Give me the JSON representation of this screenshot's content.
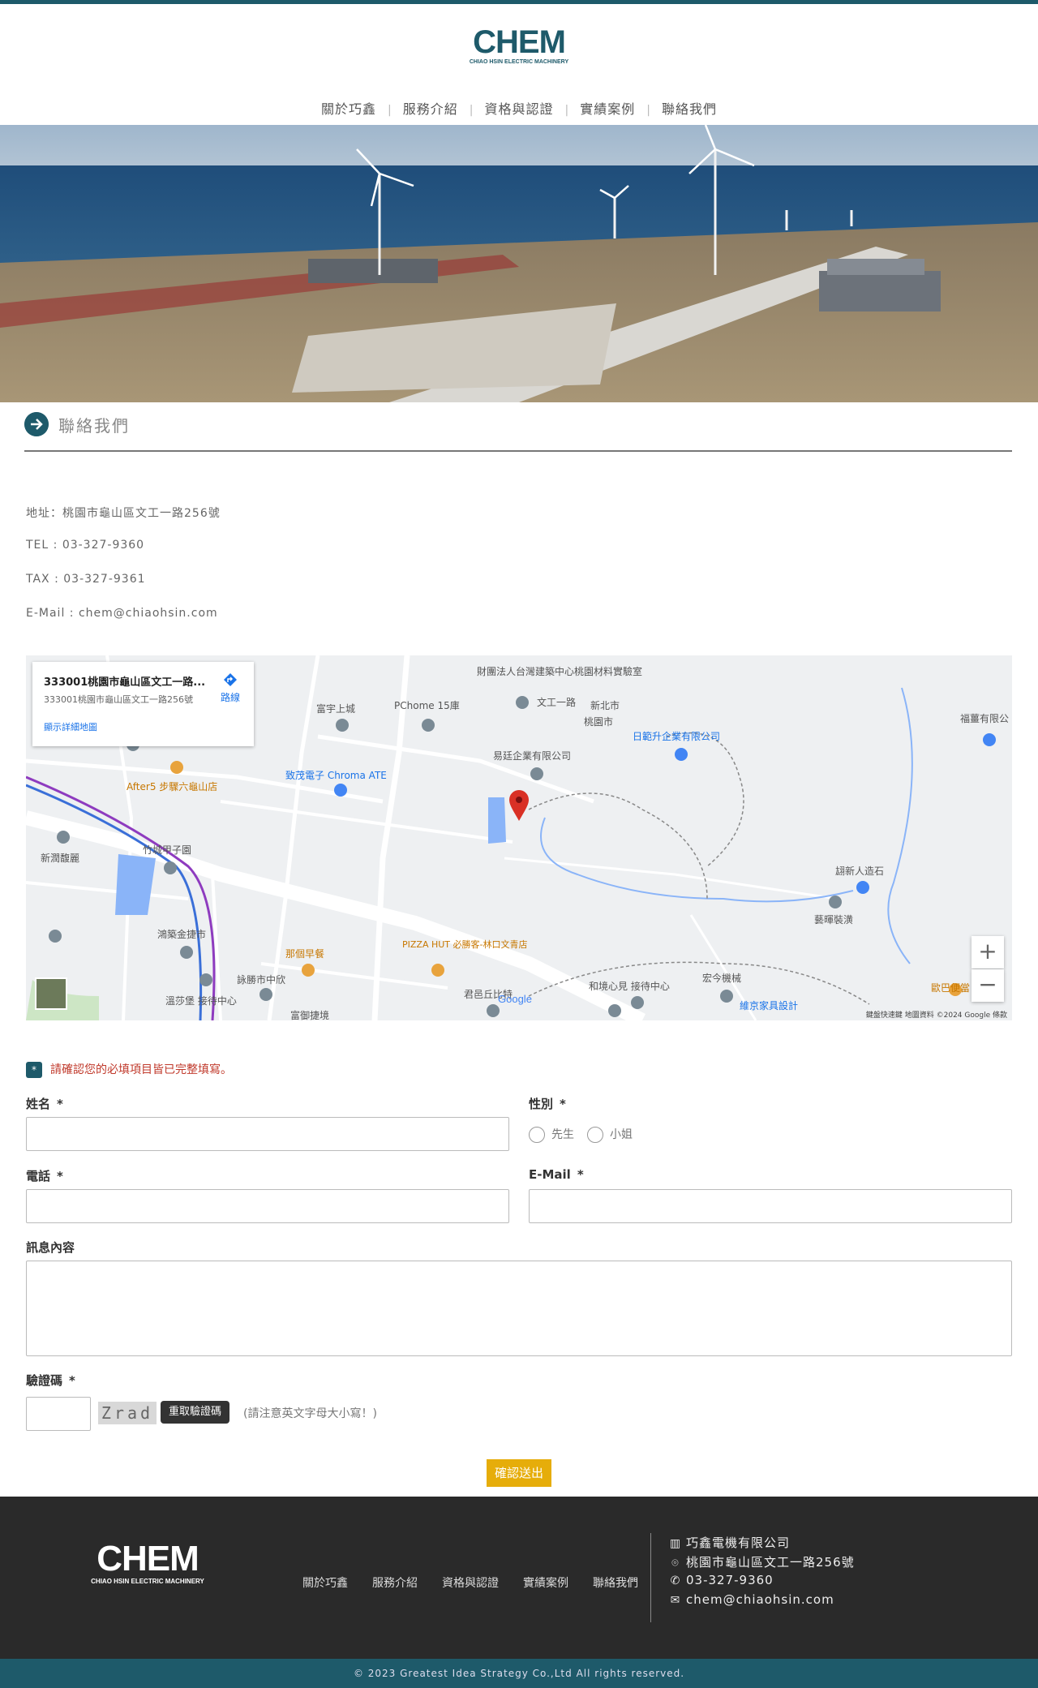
{
  "brand": {
    "logo_text": "CHEM",
    "logo_sub": "CHIAO HSIN ELECTRIC MACHINERY",
    "color_primary": "#1e5a6a",
    "color_accent": "#e6ad0a"
  },
  "nav": {
    "items": [
      "關於巧鑫",
      "服務介紹",
      "資格與認證",
      "實績案例",
      "聯絡我們"
    ]
  },
  "page": {
    "title": "聯絡我們"
  },
  "contact": {
    "address": "地址：桃園市龜山區文工一路256號",
    "tel": "TEL : 03-327-9360",
    "fax": "TAX : 03-327-9361",
    "email": "E-Mail : chem@chiaohsin.com"
  },
  "map": {
    "card_title": "333001桃園市龜山區文工一路...",
    "card_address": "333001桃園市龜山區文工一路256號",
    "card_link": "顯示詳細地圖",
    "card_route": "路線",
    "zoom_in": "+",
    "zoom_out": "−",
    "labels": [
      "財團法人台灣建築中心桃園材料實驗室",
      "富宇上城",
      "PChome 15庫",
      "文工一路",
      "新北市",
      "桃園市",
      "日範升企業有限公司",
      "易廷企業有限公司",
      "致茂電子 Chroma ATE",
      "After5 步驟六龜山店",
      "竹城甲子園",
      "新潤馥麗",
      "鴻築金捷市",
      "那個早餐",
      "PIZZA HUT 必勝客-林口文青店",
      "詠勝市中欣",
      "溫莎堡 接待中心",
      "君邑丘比特",
      "和境心見 接待中心",
      "宏今機械",
      "翃新人造石",
      "藝暉裝潢",
      "福薑有限公",
      "維京家具設計",
      "歐巴便當",
      "富御捷境"
    ],
    "attribution": "鍵盤快速鍵  地圖資料 ©2024 Google  條款",
    "google_mark": "Google"
  },
  "form": {
    "notice": "請確認您的必填項目皆已完整填寫。",
    "notice_icon": "*",
    "name_label": "姓名",
    "gender_label": "性別",
    "gender_options": [
      "先生",
      "小姐"
    ],
    "phone_label": "電話",
    "email_label": "E-Mail",
    "message_label": "訊息內容",
    "captcha_label": "驗證碼",
    "captcha_text": "Zrad",
    "captcha_reload": "重取驗證碼",
    "captcha_hint": "(請注意英文字母大小寫！)",
    "required_mark": "*",
    "submit": "確認送出"
  },
  "footer": {
    "nav": [
      "關於巧鑫",
      "服務介紹",
      "資格與認證",
      "實績案例",
      "聯絡我們"
    ],
    "company": "巧鑫電機有限公司",
    "address": "桃園市龜山區文工一路256號",
    "phone": "03-327-9360",
    "email": "chem@chiaohsin.com",
    "copyright": "© 2023 Greatest Idea Strategy Co.,Ltd All rights reserved."
  }
}
